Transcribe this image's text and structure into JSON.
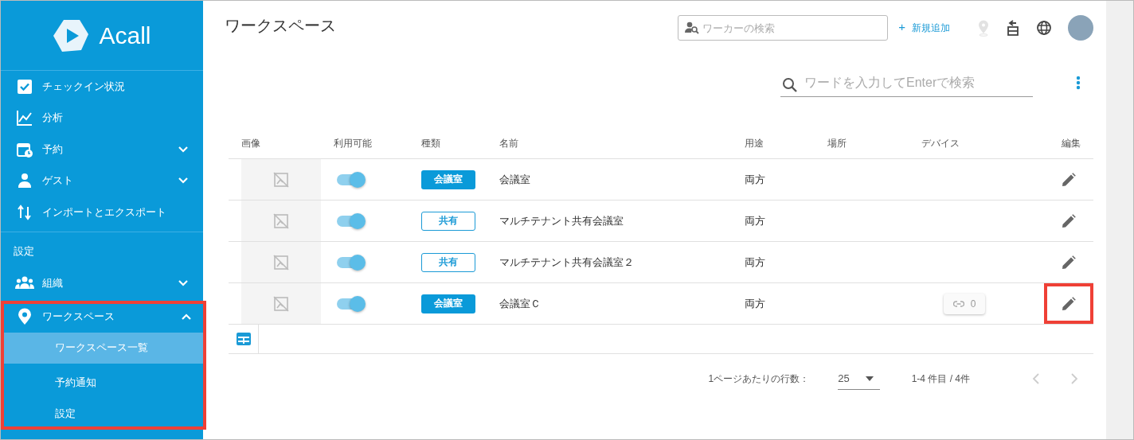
{
  "sidebar": {
    "logo": "Acall",
    "main_items": [
      {
        "label": "チェックイン状況",
        "has_children": false
      },
      {
        "label": "分析",
        "has_children": false
      },
      {
        "label": "予約",
        "has_children": true,
        "expanded": false
      },
      {
        "label": "ゲスト",
        "has_children": true,
        "expanded": false
      },
      {
        "label": "インポートとエクスポート",
        "has_children": false
      }
    ],
    "section_title": "設定",
    "settings_items": [
      {
        "label": "組織",
        "has_children": true,
        "expanded": false,
        "highlighted": false
      },
      {
        "label": "ワークスペース",
        "has_children": true,
        "expanded": true,
        "highlighted": true,
        "children": [
          {
            "label": "ワークスペース一覧",
            "selected": true
          },
          {
            "label": "予約通知",
            "selected": false
          },
          {
            "label": "設定",
            "selected": false
          }
        ]
      }
    ]
  },
  "header": {
    "title": "ワークスペース",
    "worker_search": {
      "placeholder": "ワーカーの検索"
    },
    "add_link": {
      "icon": "+",
      "label": "新規追加"
    }
  },
  "table_search": {
    "placeholder": "ワードを入力してEnterで検索"
  },
  "table": {
    "columns": [
      "画像",
      "利用可能",
      "種類",
      "名前",
      "用途",
      "場所",
      "デバイス",
      "編集"
    ],
    "rows": [
      {
        "available": true,
        "type": {
          "label": "会議室",
          "filled": true
        },
        "name": "会議室",
        "usage": "両方",
        "device_count": null,
        "edit_highlighted": false
      },
      {
        "available": true,
        "type": {
          "label": "共有",
          "filled": false
        },
        "name": "マルチテナント共有会議室",
        "usage": "両方",
        "device_count": null,
        "edit_highlighted": false
      },
      {
        "available": true,
        "type": {
          "label": "共有",
          "filled": false
        },
        "name": "マルチテナント共有会議室２",
        "usage": "両方",
        "device_count": null,
        "edit_highlighted": false
      },
      {
        "available": true,
        "type": {
          "label": "会議室",
          "filled": true
        },
        "name": "会議室Ｃ",
        "usage": "両方",
        "device_count": "0",
        "edit_highlighted": true
      }
    ]
  },
  "pagination": {
    "rows_per_page_label": "1ページあたりの行数：",
    "rows_per_page": "25",
    "range": "1-4 件目 / 4件",
    "prev_disabled": true,
    "next_disabled": true
  }
}
